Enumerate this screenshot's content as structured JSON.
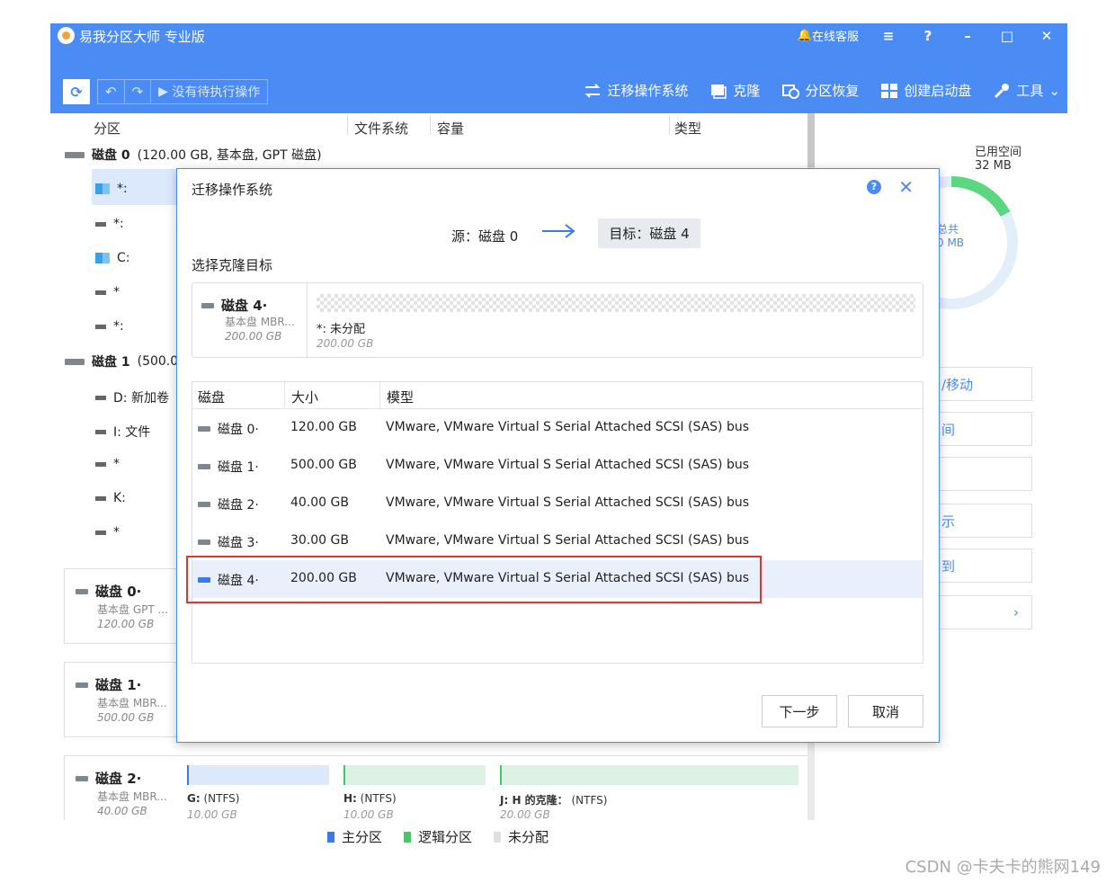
{
  "app": {
    "title": "易我分区大师 专业版",
    "support": "在线客服",
    "undo_icon": "undo-icon",
    "pending": "没有待执行操作"
  },
  "toolbar": {
    "migrate": "迁移操作系统",
    "clone": "克隆",
    "recover": "分区恢复",
    "bootdisk": "创建启动盘",
    "tools": "工具"
  },
  "columns": {
    "partition": "分区",
    "fs": "文件系统",
    "capacity": "容量",
    "type": "类型"
  },
  "tree": {
    "disk0": {
      "name": "磁盘 0",
      "info": "(120.00 GB, 基本盘, GPT 磁盘)"
    },
    "disk0_parts": [
      "*:",
      "*:",
      "C:",
      "*",
      "*:"
    ],
    "disk1": {
      "name": "磁盘 1",
      "info": "(500.0"
    },
    "disk1_parts": [
      "D: 新加卷",
      "I: 文件",
      "*",
      "K:",
      "*"
    ]
  },
  "cards": [
    {
      "name": "磁盘 0·",
      "type": "基本盘 GPT ...",
      "size": "120.00 GB"
    },
    {
      "name": "磁盘 1·",
      "type": "基本盘 MBR...",
      "size": "500.00 GB"
    },
    {
      "name": "磁盘 2·",
      "type": "基本盘 MBR...",
      "size": "40.00 GB"
    }
  ],
  "disk2_parts": [
    {
      "label": "G:",
      "fs": "(NTFS)",
      "size": "10.00 GB",
      "color": "#dbe9fb"
    },
    {
      "label": "H:",
      "fs": "(NTFS)",
      "size": "10.00 GB",
      "color": "#dcf3e3"
    },
    {
      "label": "J: H 的克隆：",
      "fs": "(NTFS)",
      "size": "20.00 GB",
      "color": "#dcf3e3"
    }
  ],
  "legend": [
    {
      "label": "主分区",
      "color": "#3a7be8"
    },
    {
      "label": "逻辑分区",
      "color": "#4cc46a"
    },
    {
      "label": "未分配",
      "color": "#e0e0e0"
    }
  ],
  "right": {
    "used_label": "已用空间",
    "used_value": "32 MB",
    "total_frag": "总共",
    "total_frag2": "0 MB",
    "actions": [
      "/移动",
      "间",
      "",
      "示",
      "到",
      "›"
    ]
  },
  "dialog": {
    "title": "迁移操作系统",
    "source": "源：磁盘 0",
    "target": "目标：磁盘 4",
    "select_label": "选择克隆目标",
    "target_disk": {
      "name": "磁盘 4·",
      "type": "基本盘 MBR...",
      "size": "200.00 GB",
      "part_label": "*: 未分配",
      "part_size": "200.00 GB"
    },
    "headers": {
      "disk": "磁盘",
      "size": "大小",
      "model": "模型"
    },
    "rows": [
      {
        "disk": "磁盘 0·",
        "size": "120.00 GB",
        "model": "VMware,  VMware Virtual S Serial Attached SCSI (SAS) bus"
      },
      {
        "disk": "磁盘 1·",
        "size": "500.00 GB",
        "model": "VMware,  VMware Virtual S Serial Attached SCSI (SAS) bus"
      },
      {
        "disk": "磁盘 2·",
        "size": "40.00 GB",
        "model": "VMware,  VMware Virtual S Serial Attached SCSI (SAS) bus"
      },
      {
        "disk": "磁盘 3·",
        "size": "30.00 GB",
        "model": "VMware,  VMware Virtual S Serial Attached SCSI (SAS) bus"
      },
      {
        "disk": "磁盘 4·",
        "size": "200.00 GB",
        "model": "VMware,  VMware Virtual S Serial Attached SCSI (SAS) bus"
      }
    ],
    "next": "下一步",
    "cancel": "取消"
  },
  "watermark": "CSDN @卡夫卡的熊网149"
}
